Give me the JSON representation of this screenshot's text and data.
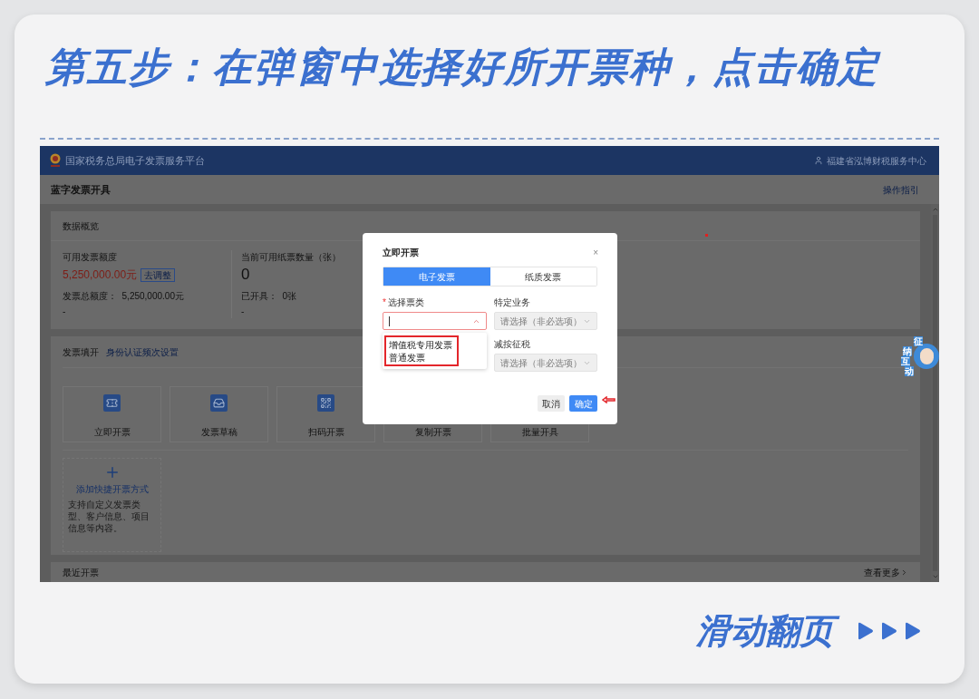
{
  "heading": "第五步：在弹窗中选择好所开票种，点击确定",
  "screen": {
    "header": {
      "title": "国家税务总局电子发票服务平台",
      "user": "福建省泓博财税服务中心"
    },
    "page_title": "蓝字发票开具",
    "guide_link": "操作指引",
    "overview": {
      "title": "数据概览",
      "stats": [
        {
          "label": "可用发票额度",
          "value": "5,250,000.00元",
          "action": "去调整",
          "detail": "发票总额度：  5,250,000.00元",
          "note": "-"
        },
        {
          "label": "当前可用纸票数量（张）",
          "value": "0",
          "detail": "已开具：  0张",
          "note": "-"
        }
      ]
    },
    "fill": {
      "title": "发票填开",
      "link": "身份认证频次设置",
      "shortcuts": [
        {
          "kind": "ticket",
          "label": "立即开票"
        },
        {
          "kind": "draft",
          "label": "发票草稿"
        },
        {
          "kind": "qr",
          "label": "扫码开票"
        },
        {
          "kind": "none",
          "label": "复制开票"
        },
        {
          "kind": "none",
          "label": "批量开具"
        }
      ],
      "add": {
        "label": "添加快捷开票方式",
        "desc": "支持自定义发票类型、客户信息、项目信息等内容。"
      }
    },
    "recent": {
      "title": "最近开票",
      "more": "查看更多"
    },
    "mascot": [
      "征",
      "纳",
      "互",
      "动"
    ],
    "modal": {
      "title": "立即开票",
      "close": "×",
      "required_mark": "*",
      "tabs": [
        {
          "label": "电子发票",
          "selected": true
        },
        {
          "label": "纸质发票",
          "selected": false
        }
      ],
      "fields": [
        {
          "label": "选择票类",
          "required": true,
          "disabled": false,
          "open": true
        },
        {
          "label": "特定业务",
          "required": false,
          "placeholder": "请选择（非必选项）",
          "disabled": true,
          "open": false
        },
        {
          "label": "减按征税",
          "required": false,
          "placeholder": "请选择（非必选项）",
          "disabled": true,
          "open": false
        }
      ],
      "options": [
        "增值税专用发票",
        "普通发票"
      ],
      "cancel": "取消",
      "confirm": "确定"
    }
  },
  "footer": "滑动翻页"
}
